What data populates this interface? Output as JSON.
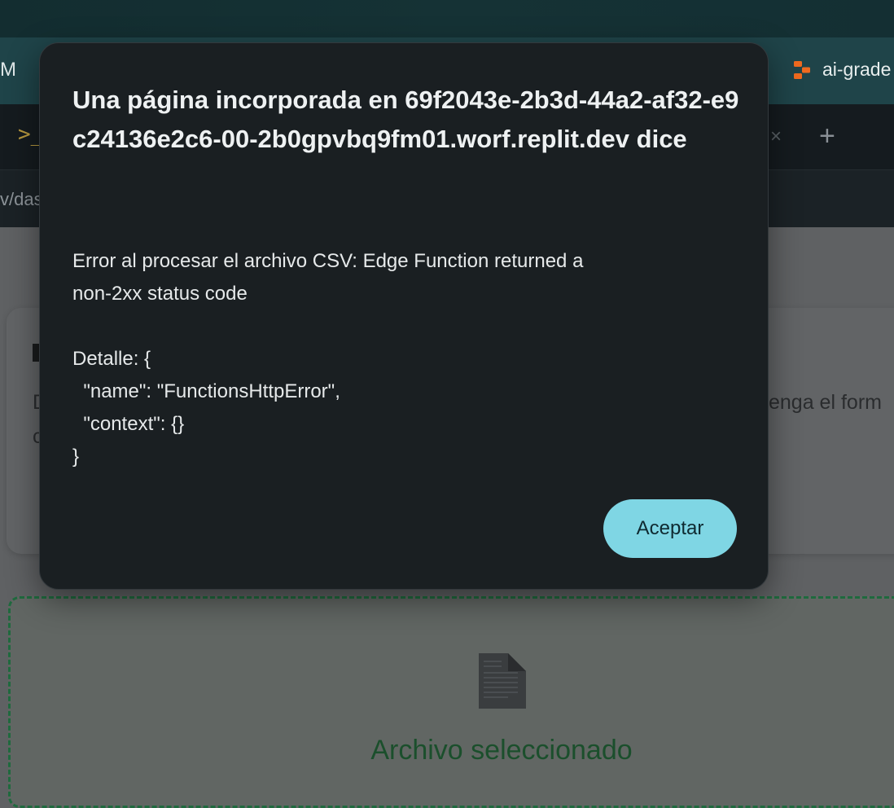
{
  "browser": {
    "bookmark_left_fragment": "M",
    "bookmark_right_label": "ai-grade",
    "tab_terminal_glyph": ">_",
    "tab_close_glyph": "×",
    "new_tab_glyph": "+",
    "url_fragment": "v/das"
  },
  "page": {
    "card_text_left_d": "D",
    "card_text_left_c": "c",
    "card_text_right": "enga el form",
    "drop_zone_label": "Archivo seleccionado",
    "drop_zone_icon": "document-icon"
  },
  "dialog": {
    "title": "Una página incorporada en 69f2043e-2b3d-44a2-af32-e9c24136e2c6-00-2b0gpvbq9fm01.worf.replit.dev dice",
    "message": "Error al procesar el archivo CSV: Edge Function returned a\nnon-2xx status code\n\nDetalle: {\n  \"name\": \"FunctionsHttpError\",\n  \"context\": {}\n}",
    "ok_label": "Aceptar"
  },
  "colors": {
    "accent_button": "#7fd6e4",
    "dialog_bg": "#1a1f22",
    "drop_border": "#1f6a3e",
    "bookmark_icon": "#ee6a1f"
  }
}
